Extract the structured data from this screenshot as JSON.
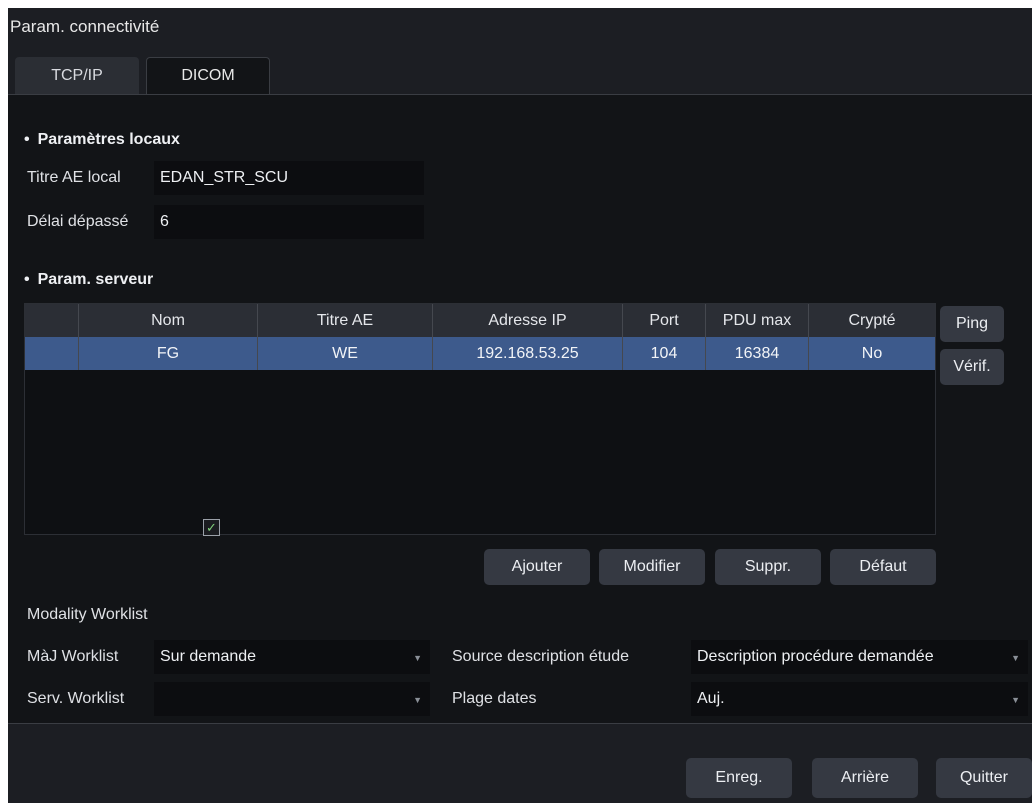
{
  "window": {
    "title": "Param. connectivité"
  },
  "tabs": [
    {
      "label": "TCP/IP",
      "active": false
    },
    {
      "label": "DICOM",
      "active": true
    }
  ],
  "local": {
    "heading": "Paramètres locaux",
    "ae_title_label": "Titre AE local",
    "ae_title_value": "EDAN_STR_SCU",
    "timeout_label": "Délai dépassé",
    "timeout_value": "6"
  },
  "server": {
    "heading": "Param. serveur",
    "columns": [
      "",
      "Nom",
      "Titre AE",
      "Adresse IP",
      "Port",
      "PDU max",
      "Crypté"
    ],
    "rows": [
      [
        "",
        "FG",
        "WE",
        "192.168.53.25",
        "104",
        "16384",
        "No"
      ]
    ],
    "side_buttons": {
      "ping": "Ping",
      "verify": "Vérif."
    },
    "actions": {
      "add": "Ajouter",
      "modify": "Modifier",
      "delete": "Suppr.",
      "default": "Défaut"
    }
  },
  "worklist": {
    "modality_label": "Modality Worklist",
    "modality_checked": true,
    "update_label": "MàJ Worklist",
    "update_value": "Sur demande",
    "server_label": "Serv. Worklist",
    "server_value": "",
    "study_desc_label": "Source description étude",
    "study_desc_value": "Description procédure demandée",
    "date_range_label": "Plage dates",
    "date_range_value": "Auj."
  },
  "footer": {
    "save": "Enreg.",
    "back": "Arrière",
    "quit": "Quitter"
  },
  "colors": {
    "background": "#1c1e23",
    "panel": "#121417",
    "selected_row": "#3d5a8c",
    "button": "#353942"
  }
}
